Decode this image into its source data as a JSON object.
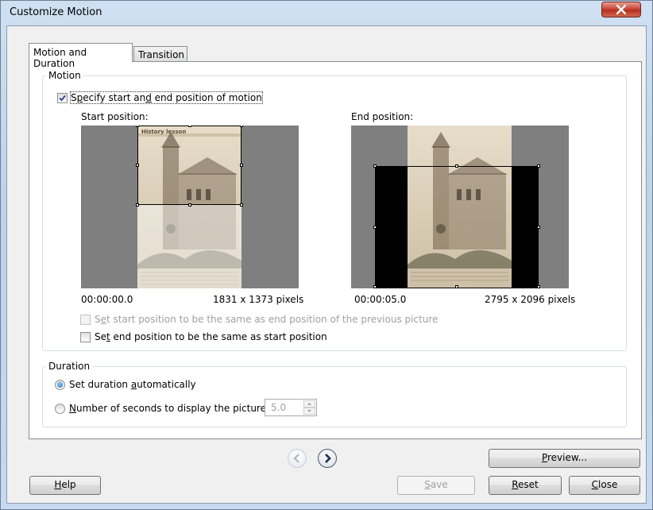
{
  "window": {
    "title": "Customize Motion"
  },
  "tabs": [
    {
      "label": "Motion and Duration",
      "active": true
    },
    {
      "label": "Transition",
      "active": false
    }
  ],
  "motion_group": {
    "label": "Motion",
    "specify_checkbox": {
      "label_pre": "S",
      "label_u1": "p",
      "label_mid": "ecify start an",
      "label_u2": "d",
      "label_post": " end position of motion",
      "checked": true
    },
    "start_position": {
      "label": "Start position:",
      "time": "00:00:00.0",
      "size": "1831 x 1373 pixels"
    },
    "end_position": {
      "label": "End position:",
      "time": "00:00:05.0",
      "size": "2795 x 2096 pixels"
    },
    "photo_caption": "History lesson",
    "same_as_previous_checkbox": {
      "pre": "S",
      "u": "e",
      "post": "t start position to be the same as end position of the previous picture",
      "checked": false,
      "enabled": false
    },
    "same_as_start_checkbox": {
      "pre": "Se",
      "u": "t",
      "post": " end position to be the same as start position",
      "checked": false,
      "enabled": true
    }
  },
  "duration_group": {
    "label": "Duration",
    "auto_radio": {
      "pre": "Set duration ",
      "u": "a",
      "post": "utomatically",
      "selected": true
    },
    "seconds_radio": {
      "pre": "",
      "u": "N",
      "post": "umber of seconds to display the picture",
      "selected": false
    },
    "seconds_value": "5.0"
  },
  "nav": {
    "prev_icon": "chevron-left-icon",
    "next_icon": "chevron-right-icon"
  },
  "buttons": {
    "preview": {
      "u": "P",
      "post": "review..."
    },
    "help": {
      "u": "H",
      "post": "elp"
    },
    "save": {
      "u": "S",
      "post": "ave",
      "enabled": false
    },
    "reset": {
      "u": "R",
      "post": "eset"
    },
    "close": {
      "u": "C",
      "post": "lose"
    }
  },
  "colors": {
    "accent": "#1a67c6",
    "close_button": "#c9473a",
    "pane_bg": "#7f7f7f"
  }
}
